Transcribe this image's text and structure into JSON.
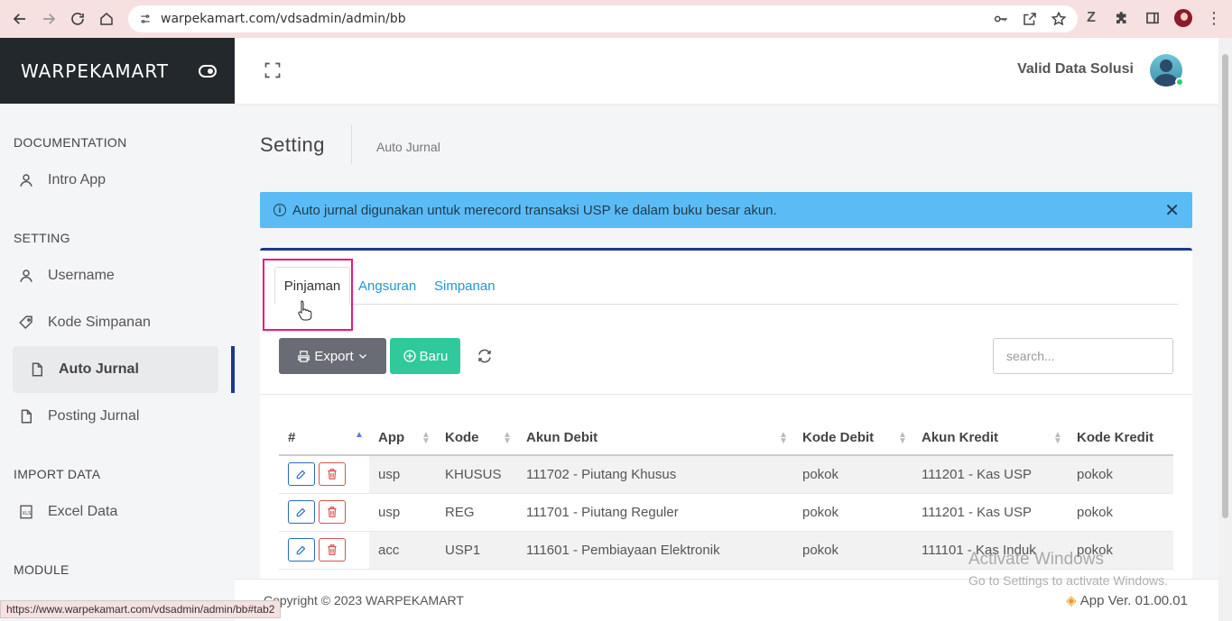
{
  "browser": {
    "url": "warpekamart.com/vdsadmin/admin/bb",
    "status_url": "https://www.warpekamart.com/vdsadmin/admin/bb#tab2"
  },
  "sidebar": {
    "brand": "WARPEKAMART",
    "sections": [
      {
        "title": "DOCUMENTATION",
        "items": [
          {
            "label": "Intro App",
            "icon": "user-icon"
          }
        ]
      },
      {
        "title": "SETTING",
        "items": [
          {
            "label": "Username",
            "icon": "user-icon"
          },
          {
            "label": "Kode Simpanan",
            "icon": "tag-icon"
          },
          {
            "label": "Auto Jurnal",
            "icon": "file-icon",
            "active": true
          },
          {
            "label": "Posting Jurnal",
            "icon": "file-icon"
          }
        ]
      },
      {
        "title": "IMPORT DATA",
        "items": [
          {
            "label": "Excel Data",
            "icon": "xls-icon"
          }
        ]
      },
      {
        "title": "MODULE",
        "items": []
      }
    ]
  },
  "header": {
    "user_name": "Valid Data Solusi"
  },
  "page": {
    "title": "Setting",
    "breadcrumb": "Auto Jurnal"
  },
  "alert": {
    "text": "Auto jurnal digunakan untuk merecord transaksi USP ke dalam buku besar akun."
  },
  "tabs": [
    "Pinjaman",
    "Angsuran",
    "Simpanan"
  ],
  "toolbar": {
    "export_label": "Export",
    "new_label": "Baru",
    "search_placeholder": "search..."
  },
  "table": {
    "columns": [
      "#",
      "App",
      "Kode",
      "Akun Debit",
      "Kode Debit",
      "Akun Kredit",
      "Kode Kredit"
    ],
    "rows": [
      {
        "app": "usp",
        "kode": "KHUSUS",
        "akun_debit": "111702 - Piutang Khusus",
        "kode_debit": "pokok",
        "akun_kredit": "111201 - Kas USP",
        "kode_kredit": "pokok"
      },
      {
        "app": "usp",
        "kode": "REG",
        "akun_debit": "111701 - Piutang Reguler",
        "kode_debit": "pokok",
        "akun_kredit": "111201 - Kas USP",
        "kode_kredit": "pokok"
      },
      {
        "app": "acc",
        "kode": "USP1",
        "akun_debit": "111601 - Pembiayaan Elektronik",
        "kode_debit": "pokok",
        "akun_kredit": "111101 - Kas Induk",
        "kode_kredit": "pokok"
      }
    ]
  },
  "footer": {
    "copyright": "Copyright © 2023 WARPEKAMART",
    "version": "App Ver. 01.00.01"
  },
  "watermark": {
    "line1": "Activate Windows",
    "line2": "Go to Settings to activate Windows."
  },
  "colors": {
    "brand_bg": "#23282d",
    "alert_bg": "#5bbcf5",
    "accent": "#1a3a8a",
    "export_btn": "#6a6c75",
    "new_btn": "#2fc99b",
    "highlight": "#e6197d",
    "tab_link": "#2196d3"
  }
}
